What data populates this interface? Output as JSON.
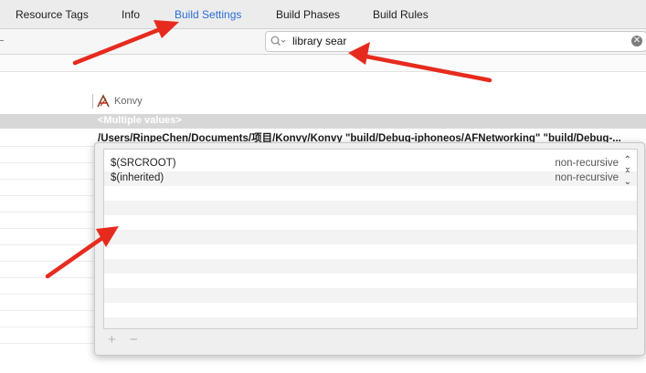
{
  "tabs": [
    "Resource Tags",
    "Info",
    "Build Settings",
    "Build Phases",
    "Build Rules"
  ],
  "active_tab": "Build Settings",
  "search": {
    "value": "library sear"
  },
  "target": {
    "name": "Konvy"
  },
  "setting": {
    "summary": "<Multiple values>",
    "value": "/Users/RinpeChen/Documents/项目/Konvy/Konvy  \"build/Debug-iphoneos/AFNetworking\" \"build/Debug-..."
  },
  "popover": {
    "rows": [
      {
        "path": "$(SRCROOT)",
        "recursion": "non-recursive"
      },
      {
        "path": "$(inherited)",
        "recursion": "non-recursive"
      }
    ],
    "add_symbol": "+",
    "remove_symbol": "−"
  },
  "annotation_color": "#e62b1e"
}
